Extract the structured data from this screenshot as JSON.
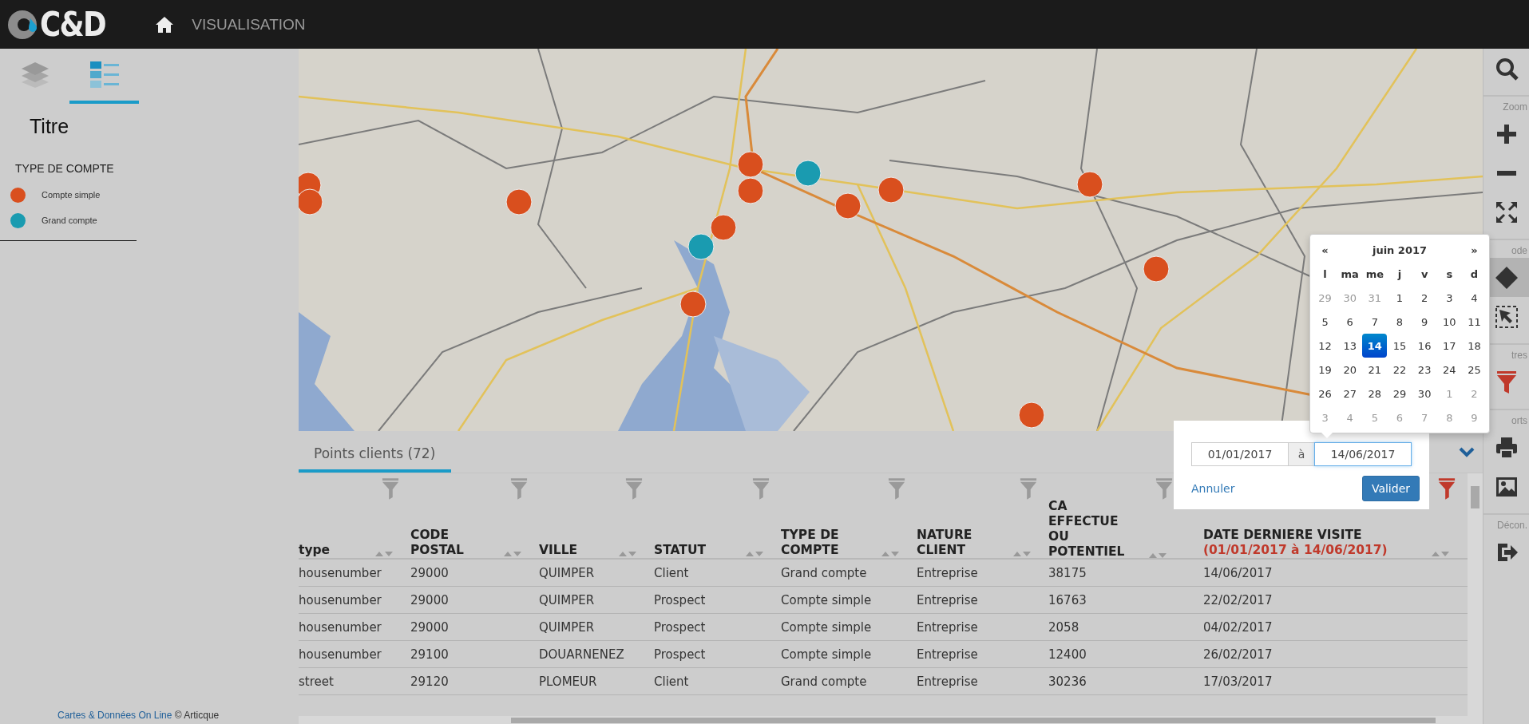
{
  "header": {
    "logo_text": "C&D",
    "nav": "VISUALISATION"
  },
  "sidebar": {
    "tabs": [
      {
        "kind": "layers",
        "selected": false
      },
      {
        "kind": "legend",
        "selected": true
      }
    ],
    "title": "Titre",
    "legend_title": "TYPE DE COMPTE",
    "legend": [
      {
        "label": "Compte simple",
        "color": "#d94f1e"
      },
      {
        "label": "Grand compte",
        "color": "#1a9bb0"
      }
    ],
    "footer": {
      "link": "Cartes & Données On Line",
      "text": "© Articque"
    }
  },
  "toolbar": [
    {
      "kind": "search",
      "selected": false
    },
    {
      "kind": "label",
      "text": "Zoom"
    },
    {
      "kind": "zoom-in",
      "selected": false
    },
    {
      "kind": "zoom-out",
      "selected": false
    },
    {
      "kind": "fullscreen",
      "selected": false
    },
    {
      "kind": "label",
      "text": "ode"
    },
    {
      "kind": "pan",
      "selected": true
    },
    {
      "kind": "select",
      "selected": false
    },
    {
      "kind": "label",
      "text": "tres"
    },
    {
      "kind": "filter",
      "selected": false
    },
    {
      "kind": "label",
      "text": "orts"
    },
    {
      "kind": "print",
      "selected": false
    },
    {
      "kind": "image",
      "selected": false
    },
    {
      "kind": "label",
      "text": "Décon."
    },
    {
      "kind": "logout",
      "selected": false
    }
  ],
  "panel": {
    "tab": {
      "label": "Points clients (72)",
      "selected": true
    },
    "columns": [
      {
        "label": "type",
        "filtered": false
      },
      {
        "label": "CODE POSTAL",
        "filtered": false
      },
      {
        "label": "VILLE",
        "filtered": false
      },
      {
        "label": "STATUT",
        "filtered": false
      },
      {
        "label": "TYPE DE COMPTE",
        "filtered": false
      },
      {
        "label": "NATURE CLIENT",
        "filtered": false
      },
      {
        "label": "CA EFFECTUE OU POTENTIEL",
        "filtered": false
      },
      {
        "label": "DATE DERNIERE VISITE",
        "filtered": true,
        "filter_note": "(01/01/2017 à 14/06/2017)"
      }
    ],
    "rows": [
      [
        "housenumber",
        "29000",
        "QUIMPER",
        "Client",
        "Grand compte",
        "Entreprise",
        "38175",
        "14/06/2017"
      ],
      [
        "housenumber",
        "29000",
        "QUIMPER",
        "Prospect",
        "Compte simple",
        "Entreprise",
        "16763",
        "22/02/2017"
      ],
      [
        "housenumber",
        "29000",
        "QUIMPER",
        "Prospect",
        "Compte simple",
        "Entreprise",
        "2058",
        "04/02/2017"
      ],
      [
        "housenumber",
        "29100",
        "DOUARNENEZ",
        "Prospect",
        "Compte simple",
        "Entreprise",
        "12400",
        "26/02/2017"
      ],
      [
        "street",
        "29120",
        "PLOMEUR",
        "Client",
        "Grand compte",
        "Entreprise",
        "30236",
        "17/03/2017"
      ]
    ]
  },
  "date_filter": {
    "from": "01/01/2017",
    "separator": "à",
    "to": "14/06/2017",
    "cancel": "Annuler",
    "confirm": "Valider"
  },
  "calendar": {
    "prev": "«",
    "title": "juin 2017",
    "next": "»",
    "weekdays": [
      "l",
      "ma",
      "me",
      "j",
      "v",
      "s",
      "d"
    ],
    "days": [
      {
        "label": "29",
        "muted": true,
        "selected": false
      },
      {
        "label": "30",
        "muted": true,
        "selected": false
      },
      {
        "label": "31",
        "muted": true,
        "selected": false
      },
      {
        "label": "1",
        "muted": false,
        "selected": false
      },
      {
        "label": "2",
        "muted": false,
        "selected": false
      },
      {
        "label": "3",
        "muted": false,
        "selected": false
      },
      {
        "label": "4",
        "muted": false,
        "selected": false
      },
      {
        "label": "5",
        "muted": false,
        "selected": false
      },
      {
        "label": "6",
        "muted": false,
        "selected": false
      },
      {
        "label": "7",
        "muted": false,
        "selected": false
      },
      {
        "label": "8",
        "muted": false,
        "selected": false
      },
      {
        "label": "9",
        "muted": false,
        "selected": false
      },
      {
        "label": "10",
        "muted": false,
        "selected": false
      },
      {
        "label": "11",
        "muted": false,
        "selected": false
      },
      {
        "label": "12",
        "muted": false,
        "selected": false
      },
      {
        "label": "13",
        "muted": false,
        "selected": false
      },
      {
        "label": "14",
        "muted": false,
        "selected": true
      },
      {
        "label": "15",
        "muted": false,
        "selected": false
      },
      {
        "label": "16",
        "muted": false,
        "selected": false
      },
      {
        "label": "17",
        "muted": false,
        "selected": false
      },
      {
        "label": "18",
        "muted": false,
        "selected": false
      },
      {
        "label": "19",
        "muted": false,
        "selected": false
      },
      {
        "label": "20",
        "muted": false,
        "selected": false
      },
      {
        "label": "21",
        "muted": false,
        "selected": false
      },
      {
        "label": "22",
        "muted": false,
        "selected": false
      },
      {
        "label": "23",
        "muted": false,
        "selected": false
      },
      {
        "label": "24",
        "muted": false,
        "selected": false
      },
      {
        "label": "25",
        "muted": false,
        "selected": false
      },
      {
        "label": "26",
        "muted": false,
        "selected": false
      },
      {
        "label": "27",
        "muted": false,
        "selected": false
      },
      {
        "label": "28",
        "muted": false,
        "selected": false
      },
      {
        "label": "29",
        "muted": false,
        "selected": false
      },
      {
        "label": "30",
        "muted": false,
        "selected": false
      },
      {
        "label": "1",
        "muted": true,
        "selected": false
      },
      {
        "label": "2",
        "muted": true,
        "selected": false
      },
      {
        "label": "3",
        "muted": true,
        "selected": false
      },
      {
        "label": "4",
        "muted": true,
        "selected": false
      },
      {
        "label": "5",
        "muted": true,
        "selected": false
      },
      {
        "label": "6",
        "muted": true,
        "selected": false
      },
      {
        "label": "7",
        "muted": true,
        "selected": false
      },
      {
        "label": "8",
        "muted": true,
        "selected": false
      },
      {
        "label": "9",
        "muted": true,
        "selected": false
      }
    ]
  }
}
